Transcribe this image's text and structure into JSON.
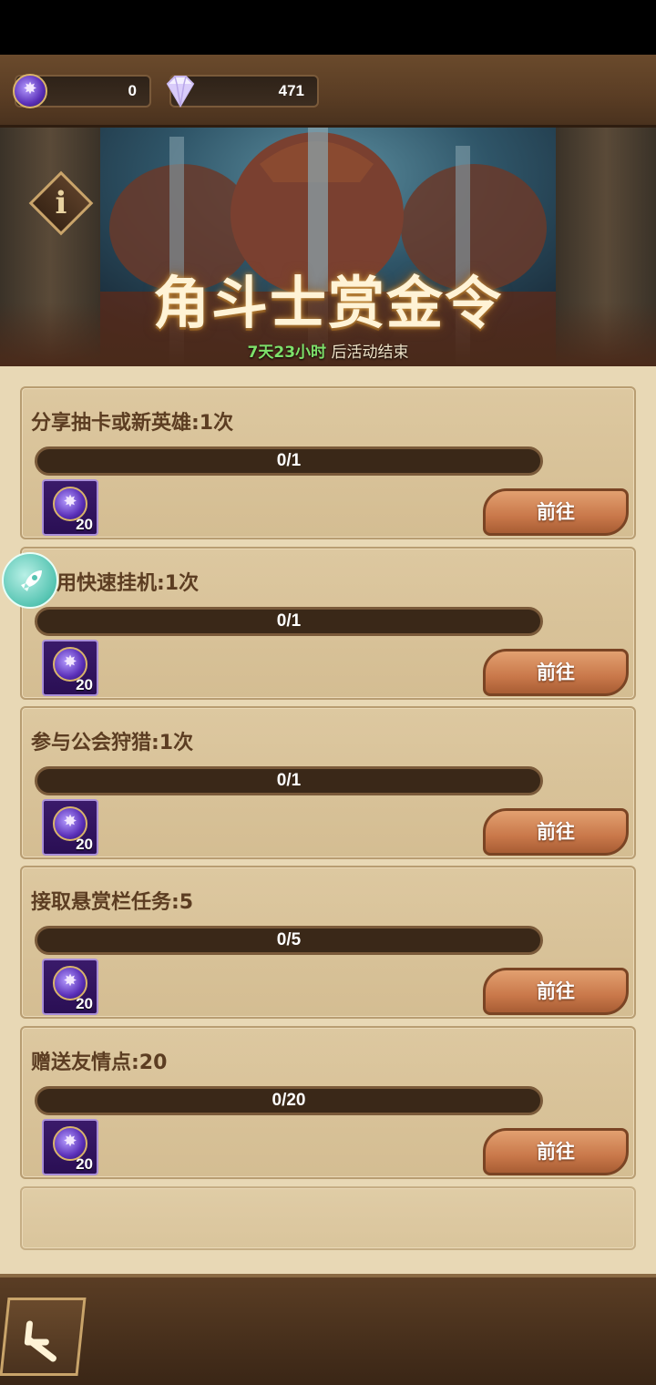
{
  "currency": {
    "coin_icon": "gladiator-coin-icon",
    "coin_value": "0",
    "gem_icon": "diamond-icon",
    "gem_value": "471"
  },
  "banner": {
    "title": "角斗士赏金令",
    "timer_highlight": "7天23小时",
    "timer_suffix": " 后活动结束",
    "info_glyph": "i"
  },
  "tasks": [
    {
      "title": "分享抽卡或新英雄:1次",
      "progress": "0/1",
      "progress_fraction": 0,
      "reward": "20",
      "button": "前往"
    },
    {
      "title": "用快速挂机:1次",
      "progress": "0/1",
      "progress_fraction": 0,
      "reward": "20",
      "button": "前往"
    },
    {
      "title": "参与公会狩猎:1次",
      "progress": "0/1",
      "progress_fraction": 0,
      "reward": "20",
      "button": "前往"
    },
    {
      "title": "接取悬赏栏任务:5",
      "progress": "0/5",
      "progress_fraction": 0,
      "reward": "20",
      "button": "前往"
    },
    {
      "title": "赠送友情点:20",
      "progress": "0/20",
      "progress_fraction": 0,
      "reward": "20",
      "button": "前往"
    }
  ],
  "colors": {
    "accent_green": "#7ee06a",
    "button_orange": "#c9784a",
    "coin_purple": "#5a2fb8"
  }
}
